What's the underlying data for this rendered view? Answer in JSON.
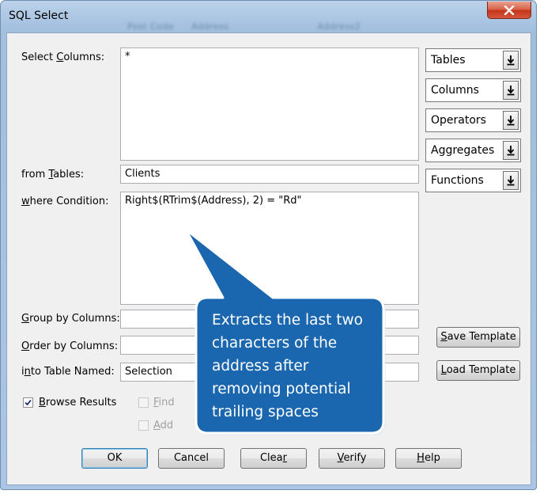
{
  "window": {
    "title": "SQL Select",
    "background_titlebar_text": [
      "Post Code",
      "Address",
      "Address2"
    ]
  },
  "labels": {
    "select_columns": {
      "pre": "Select ",
      "u": "C",
      "post": "olumns:"
    },
    "from_tables": {
      "pre": "from ",
      "u": "T",
      "post": "ables:"
    },
    "where_condition": {
      "pre": "",
      "u": "w",
      "post": "here Condition:"
    },
    "group_by": {
      "pre": "",
      "u": "G",
      "post": "roup by Columns:"
    },
    "order_by": {
      "pre": "",
      "u": "O",
      "post": "rder by Columns:"
    },
    "into_table": {
      "pre": "i",
      "u": "n",
      "post": "to Table Named:"
    }
  },
  "fields": {
    "select_columns": "*",
    "from_tables": "Clients",
    "where_condition": "Right$(RTrim$(Address), 2) = \"Rd\"",
    "group_by": "",
    "order_by": "",
    "into_table": "Selection"
  },
  "combos": [
    "Tables",
    "Columns",
    "Operators",
    "Aggregates",
    "Functions"
  ],
  "side_buttons": {
    "save_template": {
      "u": "S",
      "post": "ave Template"
    },
    "load_template": {
      "u": "L",
      "post": "oad Template"
    }
  },
  "checkboxes": {
    "browse_results": {
      "u": "B",
      "post": "rowse Results",
      "checked": true
    },
    "find_partial": {
      "u": "F",
      "post": "ind"
    },
    "add_partial": {
      "u": "A",
      "post": "dd"
    }
  },
  "buttons": {
    "ok": "OK",
    "cancel": "Cancel",
    "clear": {
      "pre": "Clea",
      "u": "r"
    },
    "verify": {
      "u": "V",
      "post": "erify"
    },
    "help": {
      "u": "H",
      "post": "elp"
    }
  },
  "callout": {
    "text": "Extracts the last two characters of the address after removing potential trailing spaces",
    "fill": "#1a67b0",
    "border": "#ffffff"
  },
  "colors": {
    "titlebar": "#a9c4e2",
    "close_button": "#c4351b",
    "dialog_bg": "#f0f0f0"
  }
}
